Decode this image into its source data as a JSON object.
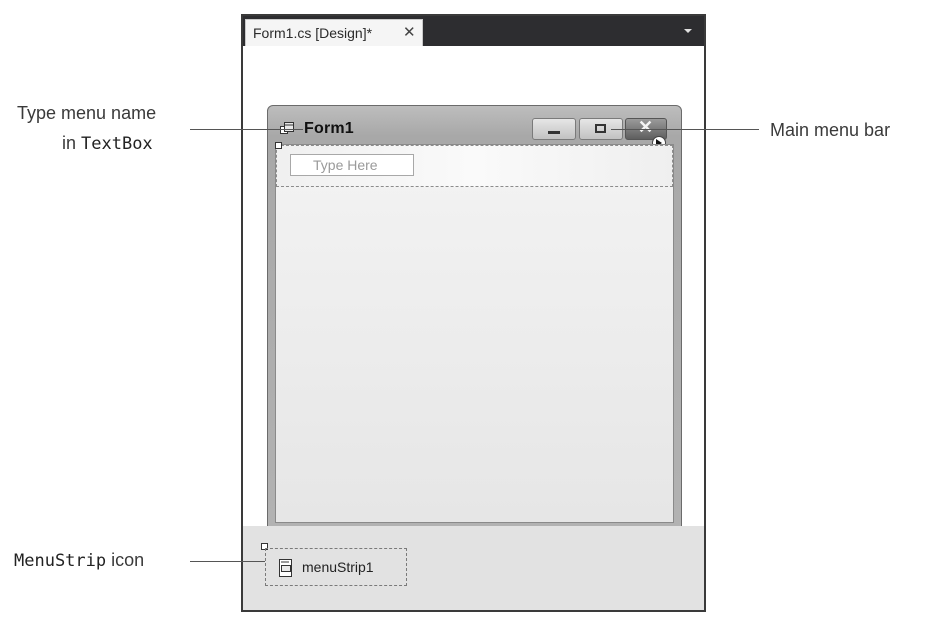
{
  "tab": {
    "title": "Form1.cs [Design]*",
    "close_glyph": "✕",
    "dropdown": "chevron-down-icon"
  },
  "form": {
    "title": "Form1",
    "icon": "form-icon",
    "minimize_icon": "minimize-icon",
    "maximize_icon": "maximize-icon",
    "close_glyph": "✕",
    "menu_textbox_placeholder": "Type Here"
  },
  "tray": {
    "component_label": "menuStrip1",
    "component_icon": "menustrip-icon"
  },
  "callouts": {
    "type_menu_line1": "Type menu name",
    "type_menu_line2_prefix": "in ",
    "type_menu_line2_code": "TextBox",
    "main_menu_bar": "Main menu bar",
    "menustrip_code": "MenuStrip",
    "menustrip_suffix": " icon"
  },
  "colors": {
    "tab_bar": "#2d2d30",
    "tray": "#e2e2e2",
    "frame": "#3a3a3a"
  }
}
